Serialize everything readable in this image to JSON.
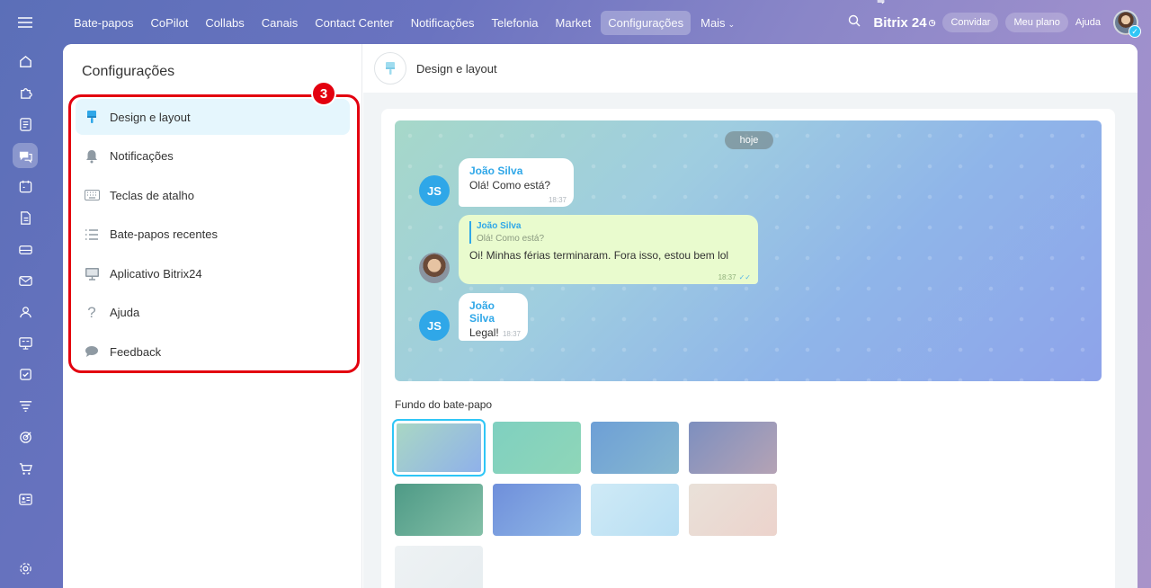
{
  "topnav": {
    "items": [
      "Bate-papos",
      "CoPilot",
      "Collabs",
      "Canais",
      "Contact Center",
      "Notificações",
      "Telefonia",
      "Market",
      "Configurações",
      "Mais"
    ],
    "active_index": 8,
    "brand": "Bitrix 24",
    "invite": "Convidar",
    "plan": "Meu plano",
    "help": "Ajuda"
  },
  "rail": {
    "icons": [
      "home-icon",
      "puzzle-icon",
      "feed-icon",
      "chat-icon",
      "calendar-icon",
      "document-icon",
      "drive-icon",
      "mail-icon",
      "groups-icon",
      "board-icon",
      "tasks-icon",
      "filter-icon",
      "target-icon",
      "cart-icon",
      "contact-card-icon"
    ],
    "active_icon": "chat-icon"
  },
  "sidebar": {
    "title": "Configurações",
    "badge": "3",
    "items": [
      {
        "label": "Design e layout",
        "icon": "brush-icon",
        "active": true
      },
      {
        "label": "Notificações",
        "icon": "bell-icon",
        "active": false
      },
      {
        "label": "Teclas de atalho",
        "icon": "keyboard-icon",
        "active": false
      },
      {
        "label": "Bate-papos recentes",
        "icon": "list-icon",
        "active": false
      },
      {
        "label": "Aplicativo Bitrix24",
        "icon": "monitor-icon",
        "active": false
      },
      {
        "label": "Ajuda",
        "icon": "question-icon",
        "active": false
      },
      {
        "label": "Feedback",
        "icon": "speech-bubble-icon",
        "active": false
      }
    ]
  },
  "content": {
    "title": "Design e layout",
    "preview": {
      "date": "hoje",
      "messages": [
        {
          "author": "João Silva",
          "initials": "JS",
          "text": "Olá! Como está?",
          "time": "18:37"
        },
        {
          "quote_author": "João Silva",
          "quote_text": "Olá! Como está?",
          "text": "Oi! Minhas férias terminaram. Fora isso, estou bem lol",
          "time": "18:37"
        },
        {
          "author": "João Silva",
          "initials": "JS",
          "text": "Legal!",
          "time": "18:37"
        }
      ]
    },
    "background_label": "Fundo do bate-papo",
    "backgrounds": [
      {
        "colors": [
          "#a9d7c4",
          "#8fb1ea"
        ],
        "selected": true
      },
      {
        "colors": [
          "#7fd0c0",
          "#8fd6b8"
        ],
        "selected": false
      },
      {
        "colors": [
          "#6d9fd6",
          "#87b8d0"
        ],
        "selected": false
      },
      {
        "colors": [
          "#7d8fbf",
          "#b5a3b5"
        ],
        "selected": false
      },
      {
        "colors": [
          "#4e9a86",
          "#84c0a8"
        ],
        "selected": false
      },
      {
        "colors": [
          "#6f8fdb",
          "#8fb7e6"
        ],
        "selected": false
      },
      {
        "colors": [
          "#cfeaf6",
          "#b7def3"
        ],
        "selected": false
      },
      {
        "colors": [
          "#e9e1d9",
          "#ecd3cc"
        ],
        "selected": false
      },
      {
        "colors": [
          "#eef2f4",
          "#e7edf0"
        ],
        "selected": false
      }
    ]
  }
}
